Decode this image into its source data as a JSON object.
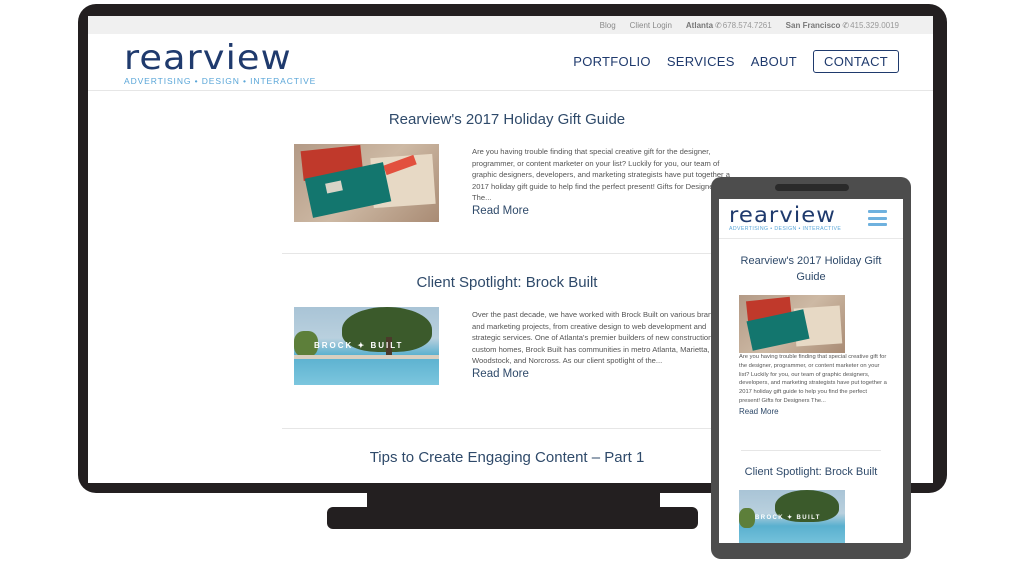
{
  "topbar": {
    "links": [
      "Blog",
      "Client Login"
    ],
    "offices": [
      {
        "city": "Atlanta",
        "phone": "678.574.7261",
        "icon": "phone-icon"
      },
      {
        "city": "San Francisco",
        "phone": "415.329.0019",
        "icon": "phone-icon"
      }
    ]
  },
  "brand": {
    "name": "rearview",
    "tagline": "ADVERTISING • DESIGN • INTERACTIVE",
    "colors": {
      "primary": "#1f3a6d",
      "accent": "#5aa6d8"
    }
  },
  "nav": {
    "items": [
      "PORTFOLIO",
      "SERVICES",
      "ABOUT"
    ],
    "cta": "CONTACT"
  },
  "posts": [
    {
      "title": "Rearview's 2017 Holiday Gift Guide",
      "excerpt": "Are you having trouble finding that special creative gift for the designer, programmer, or content marketer on your list? Luckily for you, our team of graphic designers, developers, and marketing strategists have put together a 2017 holiday gift guide to help you find the perfect present! Gifts for Designers The...",
      "excerpt_desktop": "Are you having trouble finding that special creative gift for the designer, programmer, or content marketer on your list? Luckily for you, our team of graphic designers, developers, and marketing strategists have put together a 2017 holiday gift guide to help find the perfect present! Gifts for Designers The...",
      "read_more": "Read More",
      "image": "holiday-gifts"
    },
    {
      "title": "Client Spotlight: Brock Built",
      "excerpt": "Over the past decade, we have worked with Brock Built on various branding and marketing projects, from creative design to web development and strategic services. One of Atlanta's premier builders of new construction custom homes, Brock Built has communities in metro Atlanta, Marietta, Woodstock, and Norcross. As our client spotlight of the...",
      "read_more": "Read More",
      "image": "brock-built-pool",
      "image_text": "BROCK ✦ BUILT"
    },
    {
      "title": "Tips to Create Engaging Content – Part 1"
    }
  ],
  "mobile": {
    "menu_icon": "hamburger-icon"
  }
}
